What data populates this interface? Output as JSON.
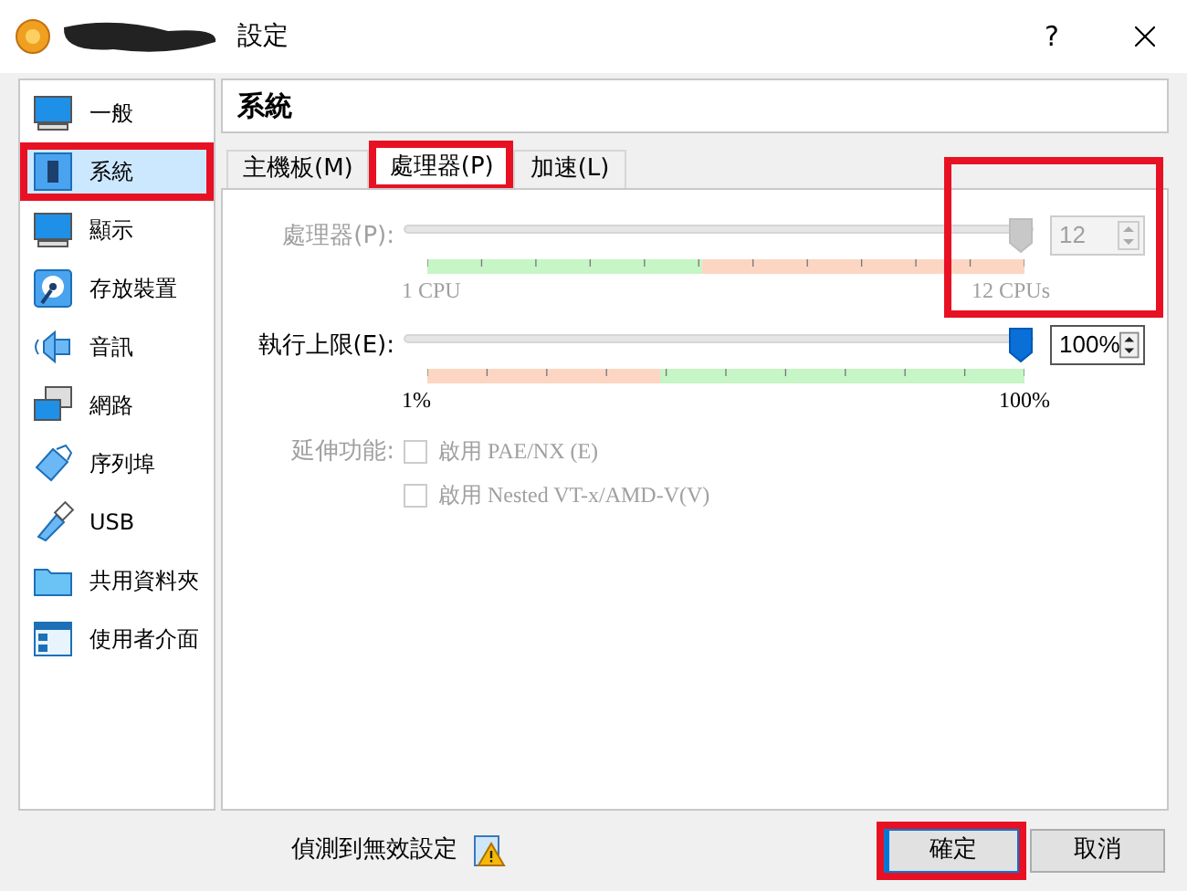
{
  "window": {
    "title": "設定",
    "help": "?"
  },
  "sidebar": {
    "items": [
      {
        "label": "一般",
        "selected": false,
        "highlighted": false
      },
      {
        "label": "系統",
        "selected": true,
        "highlighted": true
      },
      {
        "label": "顯示",
        "selected": false,
        "highlighted": false
      },
      {
        "label": "存放裝置",
        "selected": false,
        "highlighted": false
      },
      {
        "label": "音訊",
        "selected": false,
        "highlighted": false
      },
      {
        "label": "網路",
        "selected": false,
        "highlighted": false
      },
      {
        "label": "序列埠",
        "selected": false,
        "highlighted": false
      },
      {
        "label": "USB",
        "selected": false,
        "highlighted": false
      },
      {
        "label": "共用資料夾",
        "selected": false,
        "highlighted": false
      },
      {
        "label": "使用者介面",
        "selected": false,
        "highlighted": false
      }
    ]
  },
  "page_title": "系統",
  "tabs": [
    {
      "label": "主機板(M)",
      "selected": false,
      "highlighted": false
    },
    {
      "label": "處理器(P)",
      "selected": true,
      "highlighted": true
    },
    {
      "label": "加速(L)",
      "selected": false,
      "highlighted": false
    }
  ],
  "processor": {
    "label": "處理器(P):",
    "disabled": true,
    "level": 1,
    "value": "12",
    "min_label": "1 CPU",
    "max_label": "12 CPUs",
    "highlighted": true
  },
  "execution_cap": {
    "label": "執行上限(E):",
    "disabled": false,
    "level": 1,
    "value": "100%",
    "min_label": "1%",
    "max_label": "100%"
  },
  "extended_features": {
    "label": "延伸功能:",
    "disabled": true,
    "options": [
      {
        "label": "啟用 PAE/NX (E)",
        "checked": false
      },
      {
        "label": "啟用 Nested VT-x/AMD-V(V)",
        "checked": false
      }
    ]
  },
  "status": {
    "text": "偵測到無效設定"
  },
  "buttons": [
    {
      "label": "確定",
      "highlighted": true,
      "default": true
    },
    {
      "label": "取消",
      "highlighted": false,
      "default": false
    }
  ]
}
